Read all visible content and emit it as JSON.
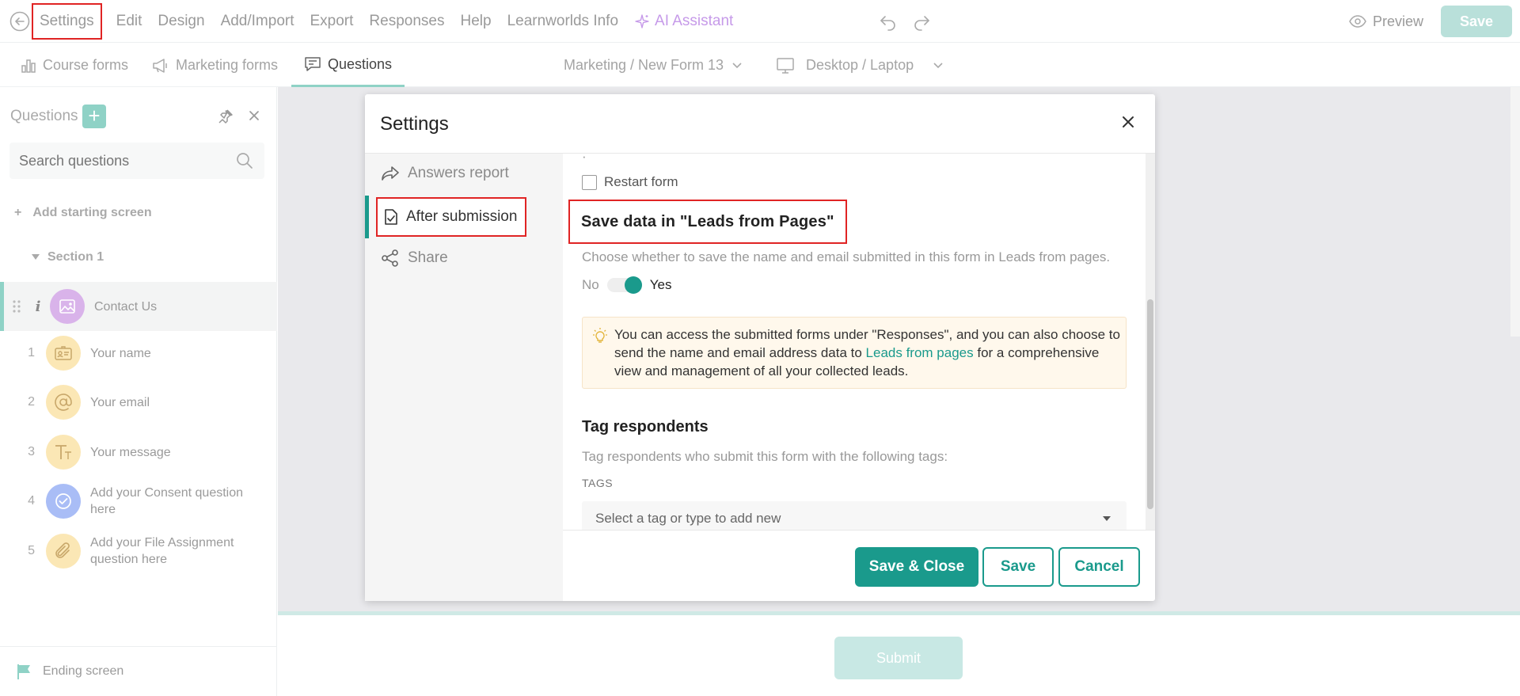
{
  "topbar": {
    "menu": [
      "Settings",
      "Edit",
      "Design",
      "Add/Import",
      "Export",
      "Responses",
      "Help",
      "Learnworlds Info"
    ],
    "ai_assistant": "AI Assistant",
    "preview": "Preview",
    "save": "Save"
  },
  "subbar": {
    "tabs": [
      "Course forms",
      "Marketing forms",
      "Questions"
    ],
    "form_selector": "Marketing / New Form 13",
    "device_selector": "Desktop / Laptop"
  },
  "questions_panel": {
    "title": "Questions",
    "search_placeholder": "Search questions",
    "add_starting_screen": "Add starting screen",
    "section": "Section 1",
    "items": [
      {
        "num": "",
        "label": "Contact Us"
      },
      {
        "num": "1",
        "label": "Your name"
      },
      {
        "num": "2",
        "label": "Your email"
      },
      {
        "num": "3",
        "label": "Your message"
      },
      {
        "num": "4",
        "label": "Add your Consent question here"
      },
      {
        "num": "5",
        "label": "Add your File Assignment question here"
      }
    ],
    "ending_screen": "Ending screen"
  },
  "canvas": {
    "submit": "Submit"
  },
  "modal": {
    "title": "Settings",
    "side_items": [
      "Answers report",
      "After submission",
      "Share"
    ],
    "restart_form": "Restart form",
    "save_data_heading": "Save data in \"Leads from Pages\"",
    "save_data_desc": "Choose whether to save the name and email submitted in this form in Leads from pages.",
    "toggle_no": "No",
    "toggle_yes": "Yes",
    "info_part1": "You can access the submitted forms under \"Responses\", and you can also choose to send the name and email address data to ",
    "info_link": "Leads from pages",
    "info_part2": " for a comprehensive view and management of all your collected leads.",
    "tag_heading": "Tag respondents",
    "tag_desc": "Tag respondents who submit this form with the following tags:",
    "tags_label": "TAGS",
    "tag_placeholder": "Select a tag or type to add new",
    "btn_save_close": "Save & Close",
    "btn_save": "Save",
    "btn_cancel": "Cancel"
  },
  "colors": {
    "accent": "#1a9a8c",
    "accent_light": "#8fd2c6",
    "highlight_outline": "#e02424"
  }
}
